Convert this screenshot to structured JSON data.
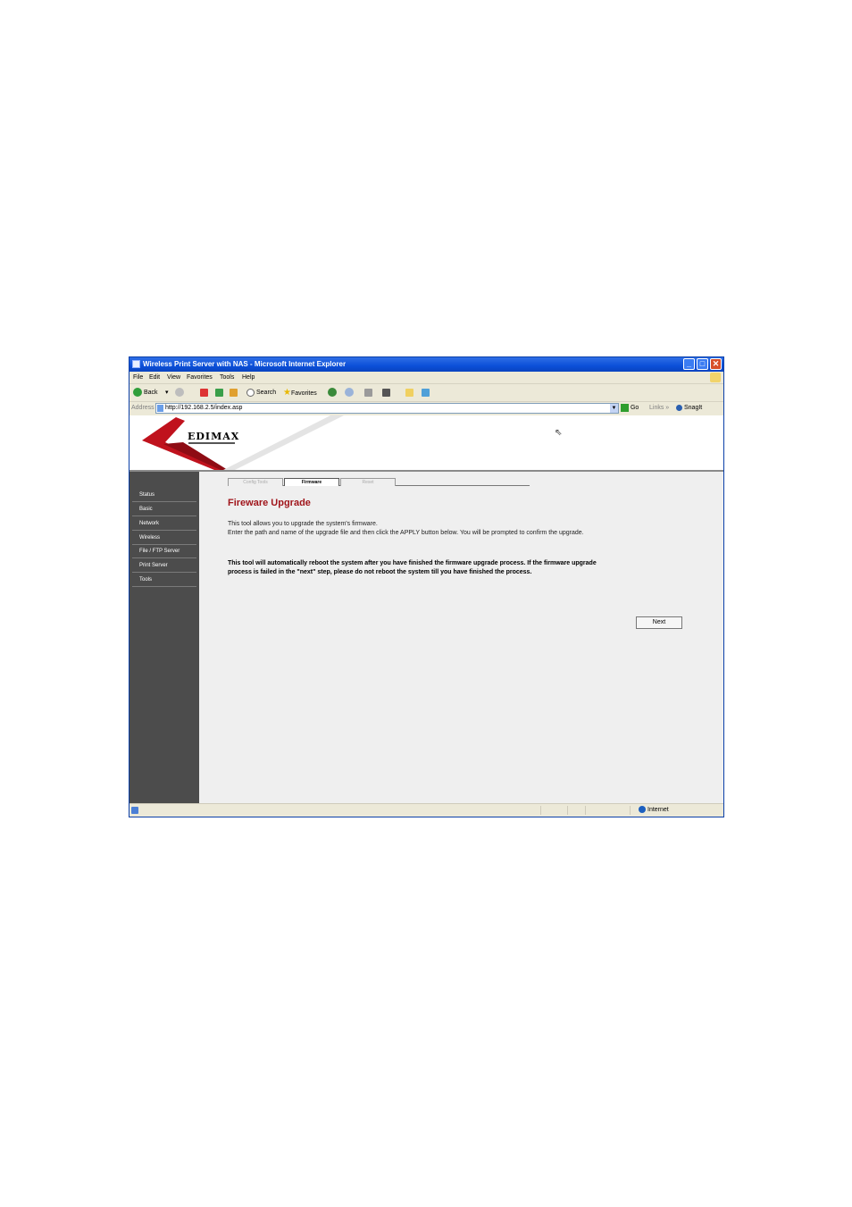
{
  "window": {
    "title": "Wireless Print Server with NAS - Microsoft Internet Explorer",
    "minimize": "_",
    "maximize": "□",
    "close": "✕"
  },
  "menu": [
    "File",
    "Edit",
    "View",
    "Favorites",
    "Tools",
    "Help"
  ],
  "toolbar": {
    "back": "Back",
    "back_arrow": "▾",
    "search": "Search",
    "favorites": "Favorites"
  },
  "address": {
    "label": "Address",
    "url": "http://192.168.2.5/index.asp",
    "go": "Go",
    "links": "Links",
    "links_arrow": "»",
    "snagit": "SnagIt"
  },
  "header": {
    "logo": "EDIMAX"
  },
  "sidebar": {
    "items": [
      "Status",
      "Basic",
      "Network",
      "Wireless",
      "File / FTP Server",
      "Print Server",
      "Tools"
    ]
  },
  "tabs": [
    {
      "label": "Config Tools",
      "active": false
    },
    {
      "label": "Firmware",
      "active": true
    },
    {
      "label": "Reset",
      "active": false
    }
  ],
  "main": {
    "title": "Fireware Upgrade",
    "desc1": "This tool allows you to upgrade the system's firmware.",
    "desc2": "Enter the path and name of the upgrade file and then click the APPLY button below. You will be prompted to confirm the upgrade.",
    "warn1": "This tool will automatically reboot the system after you have finished the firmware upgrade process. If the firmware upgrade",
    "warn2": "process is failed in the \"next\" step, please do not reboot the system till you have finished the process.",
    "next_button": "Next"
  },
  "status": {
    "zone": "Internet"
  },
  "colors": {
    "title_red": "#a0151b",
    "xp_blue": "#0b4fd8",
    "sidebar": "#4c4c4c",
    "logo_swoosh": "#c0121d"
  }
}
